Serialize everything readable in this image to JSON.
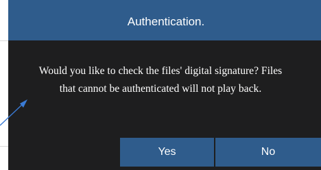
{
  "dialog": {
    "title": "Authentication.",
    "message_line1": "Would you like to check the files' digital signature? Files",
    "message_line2": "that cannot be authenticated will not play back.",
    "yes_label": "Yes",
    "no_label": "No"
  },
  "colors": {
    "dialog_background": "#1e1e1f",
    "accent": "#2f5c8c",
    "text": "#ffffff",
    "annotation_arrow": "#3a7bd5"
  },
  "icons": {
    "annotation": "arrow-icon"
  }
}
